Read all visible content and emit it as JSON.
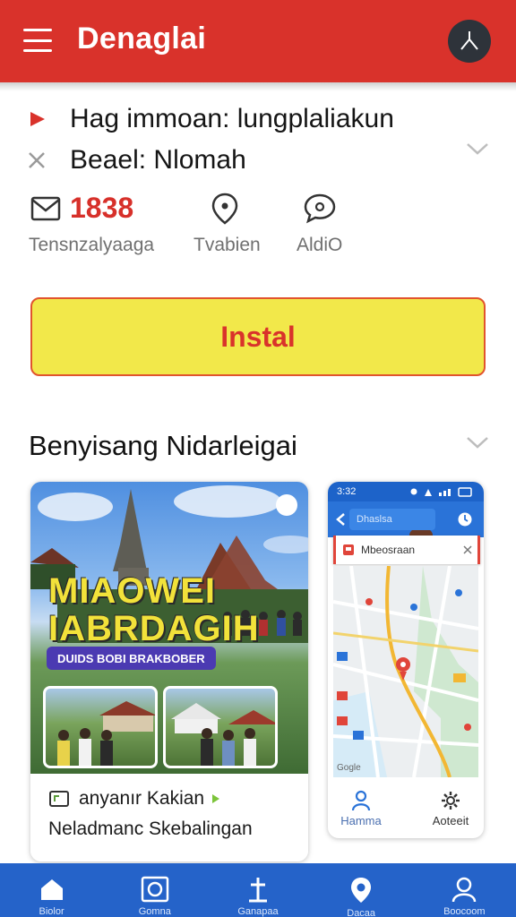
{
  "header": {
    "title": "Denaglai",
    "menu_icon": "hamburger-icon",
    "avatar_icon": "user-avatar-icon",
    "color": "#d9322b"
  },
  "info": {
    "line1": "Hag immoan: lungplaliakun",
    "line2": "Beael: Nlomah"
  },
  "stats": [
    {
      "icon": "mail-icon",
      "value": "1838",
      "label": "Tensnzalyaaga"
    },
    {
      "icon": "location-pin-icon",
      "value": "",
      "label": "Tvabien"
    },
    {
      "icon": "chat-bubble-icon",
      "value": "",
      "label": "AldiO"
    }
  ],
  "install": {
    "label": "Instal",
    "bg": "#f2e84a",
    "text_color": "#d9332b"
  },
  "section": {
    "title": "Benyisang Nidarleigai"
  },
  "card1": {
    "promo_line1": "MIAOWEI",
    "promo_line2": "IABRDAGIH",
    "promo_pill": "DUIDS BOBI BRAKBOBER",
    "footer_line1": "anyanır Kakian",
    "footer_line2": "Neladmanc Skebalingan"
  },
  "card2": {
    "status_time": "3:32",
    "search_text": "Dhaslsa",
    "route_label": "Mbeosraan",
    "map_brand": "Gogle",
    "nav_left": "Hamma",
    "nav_right": "Aoteeit"
  },
  "bottom_nav": {
    "color": "#2563c9",
    "items": [
      {
        "icon": "home-icon",
        "label": "Biolor"
      },
      {
        "icon": "camera-icon",
        "label": "Gomna"
      },
      {
        "icon": "cross-icon",
        "label": "Ganapaa"
      },
      {
        "icon": "location-icon",
        "label": "Dacaa"
      },
      {
        "icon": "profile-icon",
        "label": "Boocoom"
      }
    ]
  }
}
